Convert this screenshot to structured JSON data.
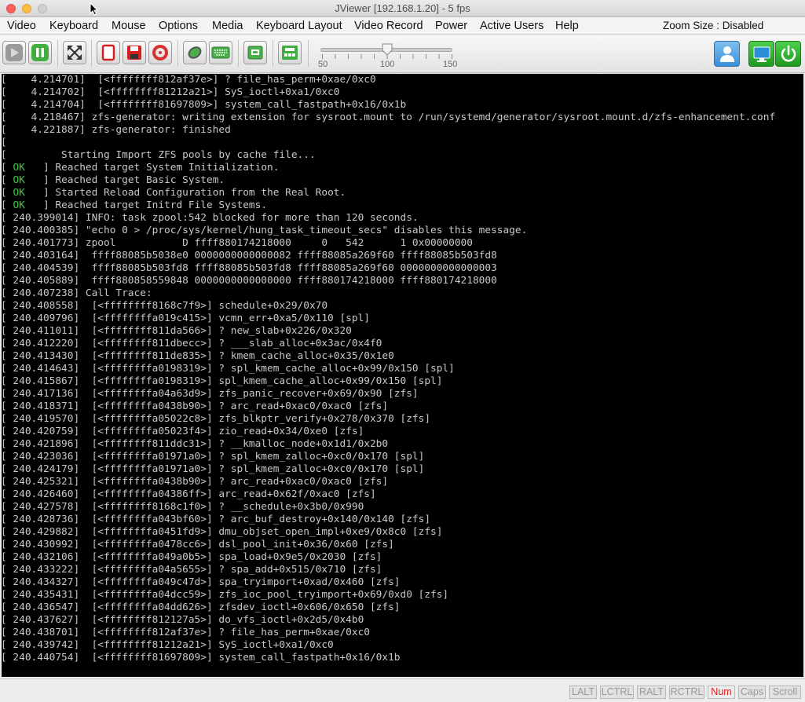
{
  "window": {
    "title": "JViewer [192.168.1.20] - 5 fps"
  },
  "menu": {
    "items": [
      "Video",
      "Keyboard",
      "Mouse",
      "Options",
      "Media",
      "Keyboard Layout",
      "Video Record",
      "Power",
      "Active Users",
      "Help"
    ],
    "zoom_size": "Zoom Size :  Disabled"
  },
  "toolbar": {
    "icons": [
      "play-icon",
      "pause-icon",
      "fullscreen-icon",
      "record-icon",
      "save-icon",
      "cdrom-icon",
      "mouse-icon",
      "keyboard-icon",
      "screenshot-icon",
      "hotkeys-icon",
      "active-user-icon",
      "video-console-icon",
      "power-icon"
    ],
    "slider": {
      "min_label": "50",
      "mid_label": "100",
      "max_label": "150",
      "value": 100
    }
  },
  "console": {
    "lines": [
      {
        "status": "",
        "text": "    4.214701]  [<ffffffff812af37e>] ? file_has_perm+0xae/0xc0"
      },
      {
        "status": "",
        "text": "    4.214702]  [<ffffffff81212a21>] SyS_ioctl+0xa1/0xc0"
      },
      {
        "status": "",
        "text": "    4.214704]  [<ffffffff81697809>] system_call_fastpath+0x16/0x1b"
      },
      {
        "status": "",
        "text": "    4.218467] zfs-generator: writing extension for sysroot.mount to /run/systemd/generator/sysroot.mount.d/zfs-enhancement.conf"
      },
      {
        "status": "",
        "text": "    4.221887] zfs-generator: finished"
      },
      {
        "status": "",
        "text": ""
      },
      {
        "status": "",
        "text": "         Starting Import ZFS pools by cache file..."
      },
      {
        "status": "OK",
        "text": " ] Reached target System Initialization."
      },
      {
        "status": "OK",
        "text": " ] Reached target Basic System."
      },
      {
        "status": "OK",
        "text": " ] Started Reload Configuration from the Real Root."
      },
      {
        "status": "OK",
        "text": " ] Reached target Initrd File Systems."
      },
      {
        "status": "",
        "text": " 240.399014] INFO: task zpool:542 blocked for more than 120 seconds."
      },
      {
        "status": "",
        "text": " 240.400385] \"echo 0 > /proc/sys/kernel/hung_task_timeout_secs\" disables this message."
      },
      {
        "status": "",
        "text": " 240.401773] zpool           D ffff880174218000     0   542      1 0x00000000"
      },
      {
        "status": "",
        "text": " 240.403164]  ffff88085b5038e0 0000000000000082 ffff88085a269f60 ffff88085b503fd8"
      },
      {
        "status": "",
        "text": " 240.404539]  ffff88085b503fd8 ffff88085b503fd8 ffff88085a269f60 0000000000000003"
      },
      {
        "status": "",
        "text": " 240.405889]  ffff880858559848 0000000000000000 ffff880174218000 ffff880174218000"
      },
      {
        "status": "",
        "text": " 240.407238] Call Trace:"
      },
      {
        "status": "",
        "text": " 240.408558]  [<ffffffff8168c7f9>] schedule+0x29/0x70"
      },
      {
        "status": "",
        "text": " 240.409796]  [<ffffffffa019c415>] vcmn_err+0xa5/0x110 [spl]"
      },
      {
        "status": "",
        "text": " 240.411011]  [<ffffffff811da566>] ? new_slab+0x226/0x320"
      },
      {
        "status": "",
        "text": " 240.412220]  [<ffffffff811dbecc>] ? ___slab_alloc+0x3ac/0x4f0"
      },
      {
        "status": "",
        "text": " 240.413430]  [<ffffffff811de835>] ? kmem_cache_alloc+0x35/0x1e0"
      },
      {
        "status": "",
        "text": " 240.414643]  [<ffffffffa0198319>] ? spl_kmem_cache_alloc+0x99/0x150 [spl]"
      },
      {
        "status": "",
        "text": " 240.415867]  [<ffffffffa0198319>] spl_kmem_cache_alloc+0x99/0x150 [spl]"
      },
      {
        "status": "",
        "text": " 240.417136]  [<ffffffffa04a63d9>] zfs_panic_recover+0x69/0x90 [zfs]"
      },
      {
        "status": "",
        "text": " 240.418371]  [<ffffffffa0438b90>] ? arc_read+0xac0/0xac0 [zfs]"
      },
      {
        "status": "",
        "text": " 240.419570]  [<ffffffffa05022c8>] zfs_blkptr_verify+0x278/0x370 [zfs]"
      },
      {
        "status": "",
        "text": " 240.420759]  [<ffffffffa05023f4>] zio_read+0x34/0xe0 [zfs]"
      },
      {
        "status": "",
        "text": " 240.421896]  [<ffffffff811ddc31>] ? __kmalloc_node+0x1d1/0x2b0"
      },
      {
        "status": "",
        "text": " 240.423036]  [<ffffffffa01971a0>] ? spl_kmem_zalloc+0xc0/0x170 [spl]"
      },
      {
        "status": "",
        "text": " 240.424179]  [<ffffffffa01971a0>] ? spl_kmem_zalloc+0xc0/0x170 [spl]"
      },
      {
        "status": "",
        "text": " 240.425321]  [<ffffffffa0438b90>] ? arc_read+0xac0/0xac0 [zfs]"
      },
      {
        "status": "",
        "text": " 240.426460]  [<ffffffffa04386ff>] arc_read+0x62f/0xac0 [zfs]"
      },
      {
        "status": "",
        "text": " 240.427578]  [<ffffffff8168c1f0>] ? __schedule+0x3b0/0x990"
      },
      {
        "status": "",
        "text": " 240.428736]  [<ffffffffa043bf60>] ? arc_buf_destroy+0x140/0x140 [zfs]"
      },
      {
        "status": "",
        "text": " 240.429882]  [<ffffffffa0451fd9>] dmu_objset_open_impl+0xe9/0x8c0 [zfs]"
      },
      {
        "status": "",
        "text": " 240.430992]  [<ffffffffa0478cc6>] dsl_pool_init+0x36/0x60 [zfs]"
      },
      {
        "status": "",
        "text": " 240.432106]  [<ffffffffa049a0b5>] spa_load+0x9e5/0x2030 [zfs]"
      },
      {
        "status": "",
        "text": " 240.433222]  [<ffffffffa04a5655>] ? spa_add+0x515/0x710 [zfs]"
      },
      {
        "status": "",
        "text": " 240.434327]  [<ffffffffa049c47d>] spa_tryimport+0xad/0x460 [zfs]"
      },
      {
        "status": "",
        "text": " 240.435431]  [<ffffffffa04dcc59>] zfs_ioc_pool_tryimport+0x69/0xd0 [zfs]"
      },
      {
        "status": "",
        "text": " 240.436547]  [<ffffffffa04dd626>] zfsdev_ioctl+0x606/0x650 [zfs]"
      },
      {
        "status": "",
        "text": " 240.437627]  [<ffffffff812127a5>] do_vfs_ioctl+0x2d5/0x4b0"
      },
      {
        "status": "",
        "text": " 240.438701]  [<ffffffff812af37e>] ? file_has_perm+0xae/0xc0"
      },
      {
        "status": "",
        "text": " 240.439742]  [<ffffffff81212a21>] SyS_ioctl+0xa1/0xc0"
      },
      {
        "status": "",
        "text": " 240.440754]  [<ffffffff81697809>] system_call_fastpath+0x16/0x1b"
      }
    ]
  },
  "statusbar": {
    "keys": [
      {
        "label": "LALT",
        "active": false
      },
      {
        "label": "LCTRL",
        "active": false
      },
      {
        "label": "RALT",
        "active": false
      },
      {
        "label": "RCTRL",
        "active": false
      },
      {
        "label": "Num",
        "active": true
      },
      {
        "label": "Caps",
        "active": false
      },
      {
        "label": "Scroll",
        "active": false
      }
    ]
  },
  "colors": {
    "console_bg": "#000000",
    "console_text": "#c8c8c8",
    "ok_green": "#45c845",
    "key_active": "#dd2020"
  }
}
